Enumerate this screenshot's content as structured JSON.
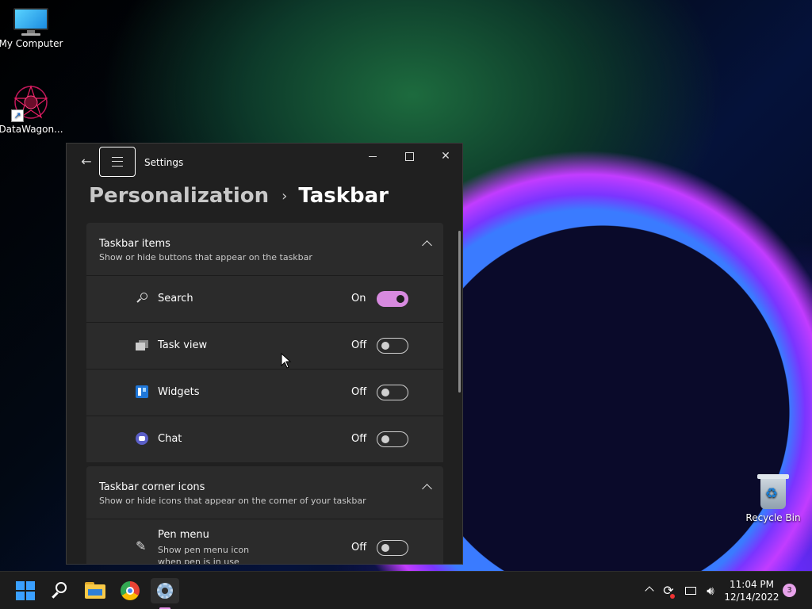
{
  "desktop": {
    "icons": [
      {
        "label": "My Computer"
      },
      {
        "label": "DataWagon..."
      },
      {
        "label": "Recycle Bin"
      }
    ]
  },
  "window": {
    "title": "Settings",
    "breadcrumb": {
      "parent": "Personalization",
      "separator": "›",
      "current": "Taskbar"
    },
    "groups": [
      {
        "title": "Taskbar items",
        "subtitle": "Show or hide buttons that appear on the taskbar",
        "items": [
          {
            "label": "Search",
            "state": "On",
            "icon": "search-icon"
          },
          {
            "label": "Task view",
            "state": "Off",
            "icon": "task-view-icon"
          },
          {
            "label": "Widgets",
            "state": "Off",
            "icon": "widgets-icon"
          },
          {
            "label": "Chat",
            "state": "Off",
            "icon": "chat-icon"
          }
        ]
      },
      {
        "title": "Taskbar corner icons",
        "subtitle": "Show or hide icons that appear on the corner of your taskbar",
        "items": [
          {
            "label": "Pen menu",
            "description": "Show pen menu icon when pen is in use",
            "state": "Off",
            "icon": "pen-icon"
          }
        ]
      }
    ]
  },
  "taskbar": {
    "clock_time": "11:04 PM",
    "clock_date": "12/14/2022",
    "notification_count": "3"
  },
  "colors": {
    "accent": "#d78adf",
    "window_bg": "#202020",
    "card_bg": "#2b2b2b",
    "taskbar_bg": "#1c1c1c"
  }
}
